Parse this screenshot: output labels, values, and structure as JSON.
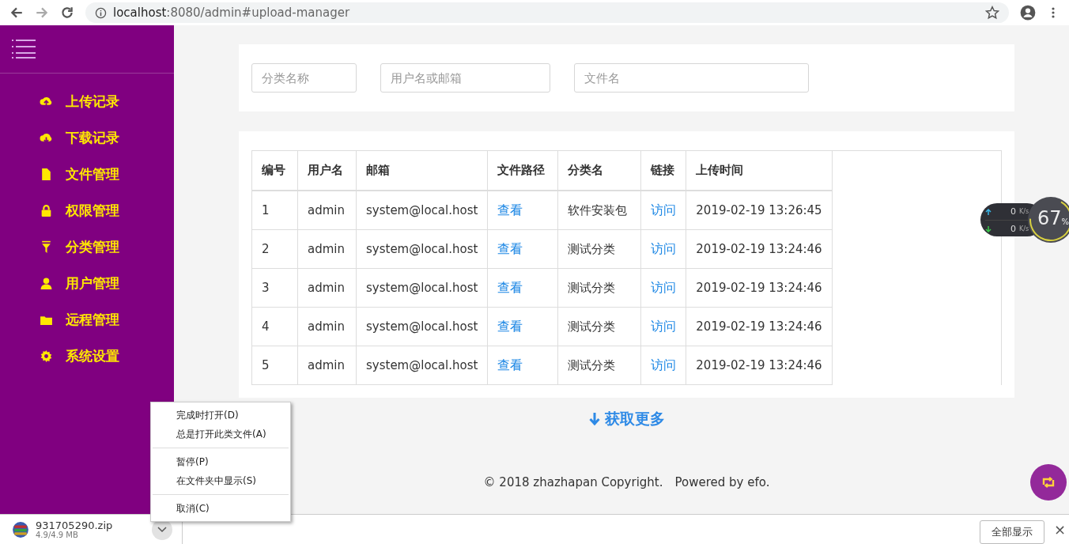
{
  "browser": {
    "url_host": "localhost",
    "url_rest": ":8080/admin#upload-manager"
  },
  "sidebar": {
    "items": [
      {
        "label": "上传记录"
      },
      {
        "label": "下载记录"
      },
      {
        "label": "文件管理"
      },
      {
        "label": "权限管理"
      },
      {
        "label": "分类管理"
      },
      {
        "label": "用户管理"
      },
      {
        "label": "远程管理"
      },
      {
        "label": "系统设置"
      }
    ]
  },
  "filters": [
    {
      "placeholder": "分类名称"
    },
    {
      "placeholder": "用户名或邮箱"
    },
    {
      "placeholder": "文件名"
    }
  ],
  "table": {
    "columns": [
      "编号",
      "用户名",
      "邮箱",
      "文件路径",
      "分类名",
      "链接",
      "上传时间"
    ],
    "rows": [
      {
        "id": "1",
        "username": "admin",
        "email": "system@local.host",
        "path_link": "查看",
        "category": "软件安装包",
        "link": "访问",
        "upload_time": "2019-02-19 13:26:45"
      },
      {
        "id": "2",
        "username": "admin",
        "email": "system@local.host",
        "path_link": "查看",
        "category": "测试分类",
        "link": "访问",
        "upload_time": "2019-02-19 13:24:46"
      },
      {
        "id": "3",
        "username": "admin",
        "email": "system@local.host",
        "path_link": "查看",
        "category": "测试分类",
        "link": "访问",
        "upload_time": "2019-02-19 13:24:46"
      },
      {
        "id": "4",
        "username": "admin",
        "email": "system@local.host",
        "path_link": "查看",
        "category": "测试分类",
        "link": "访问",
        "upload_time": "2019-02-19 13:24:46"
      },
      {
        "id": "5",
        "username": "admin",
        "email": "system@local.host",
        "path_link": "查看",
        "category": "测试分类",
        "link": "访问",
        "upload_time": "2019-02-19 13:24:46"
      }
    ]
  },
  "load_more": "获取更多",
  "footer": "© 2018 zhazhapan Copyright.　Powered by efo.",
  "download_bar": {
    "file_name": "931705290.zip",
    "size": "4.9/4.9 MB",
    "show_all": "全部显示",
    "close": "×"
  },
  "context_menu": {
    "groups": [
      [
        "完成时打开(D)",
        "总是打开此类文件(A)"
      ],
      [
        "暂停(P)",
        "在文件夹中显示(S)"
      ],
      [
        "取消(C)"
      ]
    ]
  },
  "net_widget": {
    "up_value": "0",
    "up_unit": "K/s",
    "down_value": "0",
    "down_unit": "K/s",
    "percent": "67",
    "percent_sign": "%",
    "level": 0.67
  }
}
